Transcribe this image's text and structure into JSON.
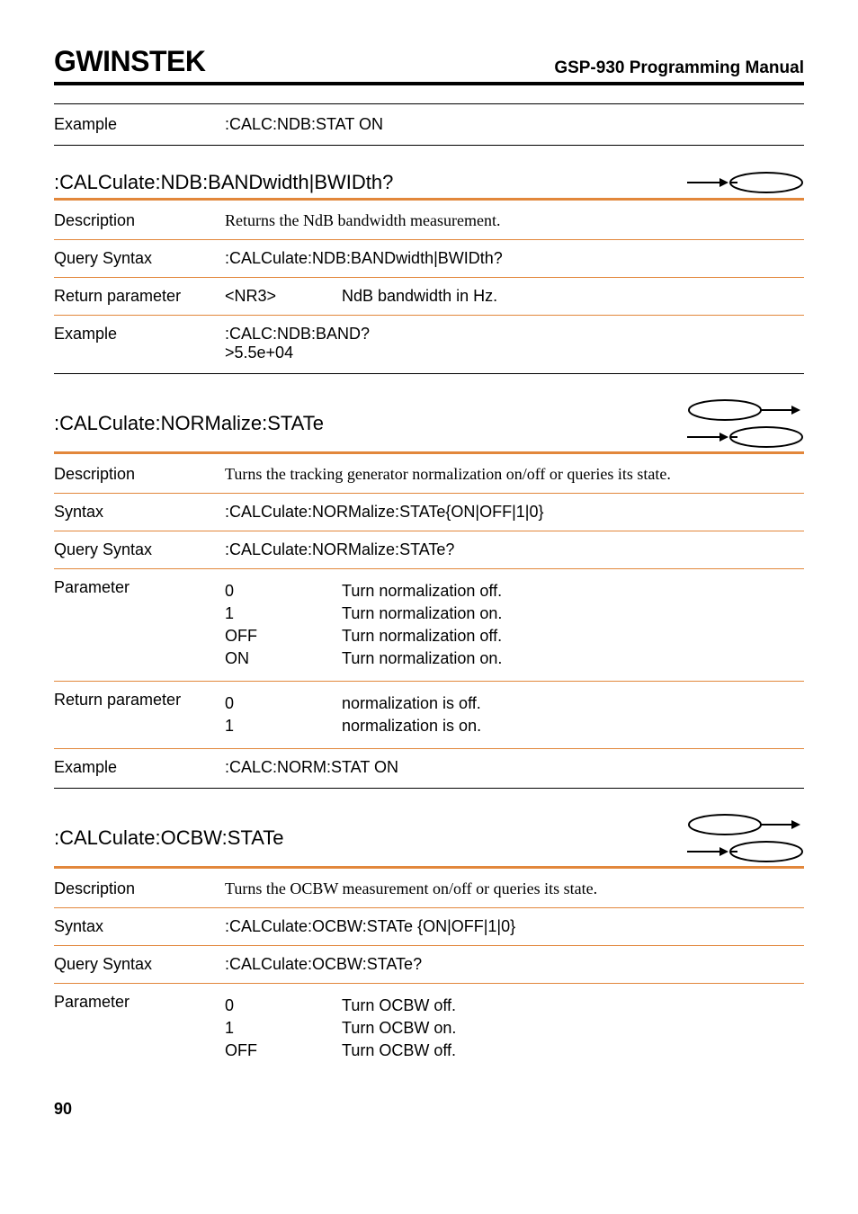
{
  "header": {
    "logo": "GWINSTEK",
    "manual_title": "GSP-930 Programming Manual"
  },
  "section1": {
    "example_label": "Example",
    "example_value": ":CALC:NDB:STAT ON"
  },
  "section2": {
    "title": ":CALCulate:NDB:BANDwidth|BWIDth?",
    "description_label": "Description",
    "description_text": "Returns the NdB bandwidth measurement.",
    "query_syntax_label": "Query Syntax",
    "query_syntax_value": ":CALCulate:NDB:BANDwidth|BWIDth?",
    "return_param_label": "Return parameter",
    "return_param_type": "<NR3>",
    "return_param_desc": "NdB bandwidth in Hz.",
    "example_label": "Example",
    "example_line1": ":CALC:NDB:BAND?",
    "example_line2": ">5.5e+04"
  },
  "section3": {
    "title": ":CALCulate:NORMalize:STATe",
    "description_label": "Description",
    "description_text": "Turns the tracking generator normalization on/off or queries its state.",
    "syntax_label": "Syntax",
    "syntax_value": ":CALCulate:NORMalize:STATe{ON|OFF|1|0}",
    "query_syntax_label": "Query Syntax",
    "query_syntax_value": ":CALCulate:NORMalize:STATe?",
    "parameter_label": "Parameter",
    "params": [
      {
        "key": "0",
        "desc": "Turn normalization off."
      },
      {
        "key": "1",
        "desc": "Turn normalization on."
      },
      {
        "key": "OFF",
        "desc": "Turn normalization off."
      },
      {
        "key": "ON",
        "desc": "Turn normalization on."
      }
    ],
    "return_param_label": "Return parameter",
    "return_params": [
      {
        "key": "0",
        "desc": "normalization is off."
      },
      {
        "key": "1",
        "desc": "normalization is on."
      }
    ],
    "example_label": "Example",
    "example_value": ":CALC:NORM:STAT ON"
  },
  "section4": {
    "title": ":CALCulate:OCBW:STATe",
    "description_label": "Description",
    "description_text": "Turns the OCBW measurement on/off or queries its state.",
    "syntax_label": "Syntax",
    "syntax_value": ":CALCulate:OCBW:STATe {ON|OFF|1|0}",
    "query_syntax_label": "Query Syntax",
    "query_syntax_value": ":CALCulate:OCBW:STATe?",
    "parameter_label": "Parameter",
    "params": [
      {
        "key": "0",
        "desc": "Turn OCBW off."
      },
      {
        "key": "1",
        "desc": "Turn OCBW on."
      },
      {
        "key": "OFF",
        "desc": "Turn OCBW off."
      }
    ]
  },
  "footer": {
    "page_number": "90"
  }
}
